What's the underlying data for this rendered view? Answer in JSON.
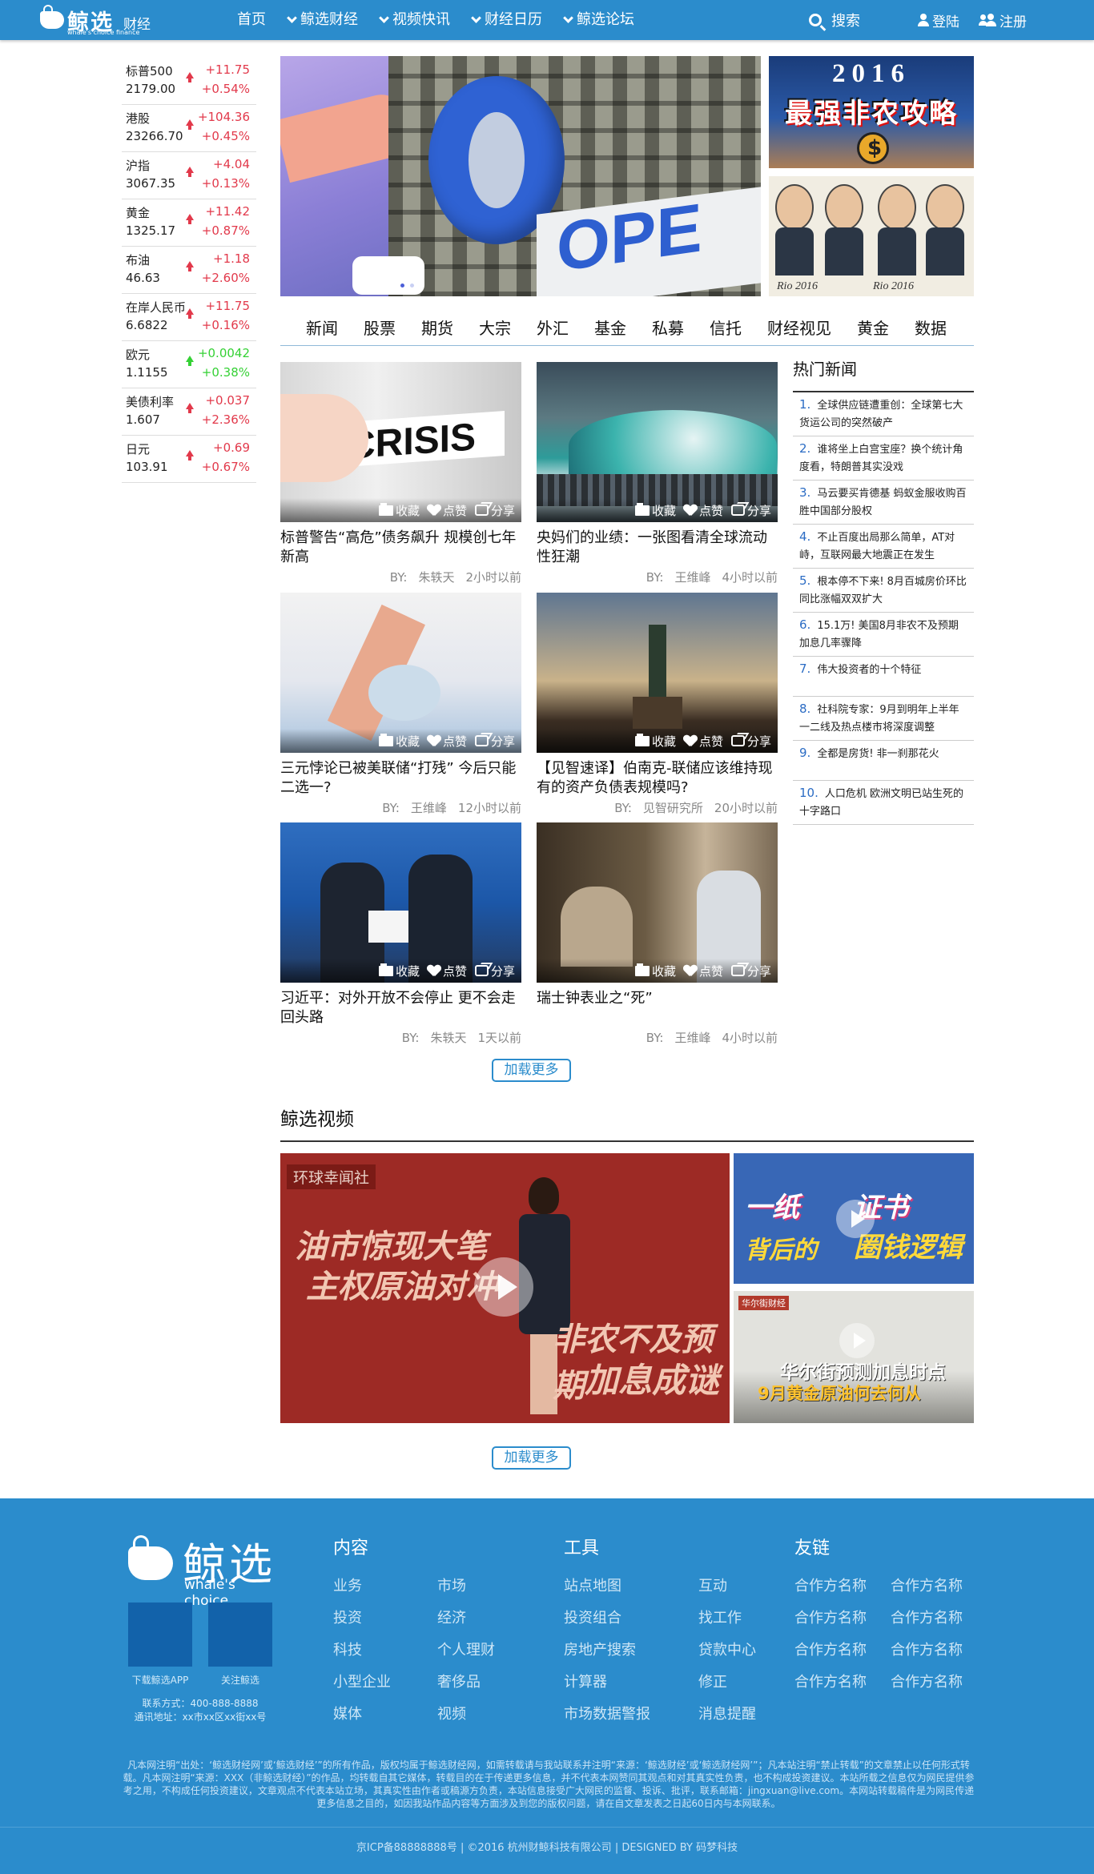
{
  "header": {
    "logo_cn": "鲸选",
    "logo_sub": "财经",
    "logo_en": "whale's choice  finance",
    "nav": [
      {
        "label": "首页",
        "has_dropdown": false
      },
      {
        "label": "鲸选财经",
        "has_dropdown": true
      },
      {
        "label": "视频快讯",
        "has_dropdown": true
      },
      {
        "label": "财经日历",
        "has_dropdown": true
      },
      {
        "label": "鲸选论坛",
        "has_dropdown": true
      }
    ],
    "search_label": "搜索",
    "login_label": "登陆",
    "register_label": "注册"
  },
  "stocks": [
    {
      "name": "标普500",
      "price": "2179.00",
      "change": "+11.75",
      "pct": "+0.54%",
      "dir": "up"
    },
    {
      "name": "港股",
      "price": "23266.70",
      "change": "+104.36",
      "pct": "+0.45%",
      "dir": "up"
    },
    {
      "name": "沪指",
      "price": "3067.35",
      "change": "+4.04",
      "pct": "+0.13%",
      "dir": "up"
    },
    {
      "name": "黄金",
      "price": "1325.17",
      "change": "+11.42",
      "pct": "+0.87%",
      "dir": "up"
    },
    {
      "name": "布油",
      "price": "46.63",
      "change": "+1.18",
      "pct": "+2.60%",
      "dir": "up"
    },
    {
      "name": "在岸人民币",
      "price": "6.6822",
      "change": "+11.75",
      "pct": "+0.16%",
      "dir": "up"
    },
    {
      "name": "欧元",
      "price": "1.1155",
      "change": "+0.0042",
      "pct": "+0.38%",
      "dir": "down"
    },
    {
      "name": "美债利率",
      "price": "1.607",
      "change": "+0.037",
      "pct": "+2.36%",
      "dir": "up"
    },
    {
      "name": "日元",
      "price": "103.91",
      "change": "+0.69",
      "pct": "+0.67%",
      "dir": "up"
    }
  ],
  "banner": {
    "main_text": "OPE",
    "side1_line1": "2016",
    "side1_line2": "最强非农攻略",
    "side2_caption1": "Rio 2016",
    "side2_caption2": "Rio 2016"
  },
  "categories": [
    "新闻",
    "股票",
    "期货",
    "大宗",
    "外汇",
    "基金",
    "私募",
    "信托",
    "财经视见",
    "黄金",
    "数据"
  ],
  "article_actions": {
    "collect": "收藏",
    "like": "点赞",
    "share": "分享"
  },
  "articles": [
    {
      "title": "标普警告“高危”债务飙升 规模创七年新高",
      "author": "朱轶天",
      "time": "2小时以前",
      "by": "BY:",
      "img": "crisis"
    },
    {
      "title": "央妈们的业绩：一张图看清全球流动性狂潮",
      "author": "王维峰",
      "time": "4小时以前",
      "by": "BY:",
      "img": "wave"
    },
    {
      "title": "三元悖论已被美联储“打残” 今后只能二选一?",
      "author": "王维峰",
      "time": "12小时以前",
      "by": "BY:",
      "img": "dancer"
    },
    {
      "title": "【见智速译】伯南克-联储应该维持现有的资产负债表规模吗?",
      "author": "见智研究所",
      "time": "20小时以前",
      "by": "BY:",
      "img": "liberty"
    },
    {
      "title": "习近平：对外开放不会停止 更不会走回头路",
      "author": "朱轶天",
      "time": "1天以前",
      "by": "BY:",
      "img": "meeting"
    },
    {
      "title": "瑞士钟表业之“死”",
      "author": "王维峰",
      "time": "4小时以前",
      "by": "BY:",
      "img": "watch"
    }
  ],
  "hot_news": {
    "title": "热门新闻",
    "items": [
      {
        "num": "1.",
        "text": "全球供应链遭重创：全球第七大货运公司的突然破产"
      },
      {
        "num": "2.",
        "text": "谁将坐上白宫宝座？换个统计角度看，特朗普其实没戏"
      },
      {
        "num": "3.",
        "text": "马云要买肯德基 蚂蚁金服收购百胜中国部分股权"
      },
      {
        "num": "4.",
        "text": "不止百度出局那么简单，AT对峙，互联网最大地震正在发生"
      },
      {
        "num": "5.",
        "text": "根本停不下来! 8月百城房价环比同比涨幅双双扩大"
      },
      {
        "num": "6.",
        "text": "15.1万! 美国8月非农不及预期 加息几率骤降"
      },
      {
        "num": "7.",
        "text": "伟大投资者的十个特征"
      },
      {
        "num": "8.",
        "text": "社科院专家：9月到明年上半年 一二线及热点楼市将深度调整"
      },
      {
        "num": "9.",
        "text": "全都是房货! 非一刹那花火"
      },
      {
        "num": "10.",
        "text": "人口危机 欧洲文明已站生死的十字路口"
      }
    ]
  },
  "load_more": "加载更多",
  "video": {
    "section_title": "鲸选视频",
    "main_tag": "环球幸闻社",
    "main_lines": [
      "油市惊现大笔",
      "主权原油对冲",
      "非农不及预期",
      "加息成谜"
    ],
    "side1_lines": [
      "一纸",
      "背后的",
      "证书",
      "圈钱逻辑"
    ],
    "side2_tag": "华尔街财经",
    "side2_lines": [
      "华尔街预测加息时点",
      "9月黄金原油何去何从"
    ]
  },
  "footer": {
    "logo_cn": "鲸选",
    "logo_en": "whale's choice",
    "qr1_label": "下载鲸选APP",
    "qr2_label": "关注鲸选",
    "contact_phone": "联系方式：400-888-8888",
    "contact_address": "通讯地址：xx市xx区xx街xx号",
    "col1_title": "内容",
    "col1_a": [
      "业务",
      "投资",
      "科技",
      "小型企业",
      "媒体"
    ],
    "col1_b": [
      "市场",
      "经济",
      "个人理财",
      "奢侈品",
      "视频"
    ],
    "col2_title": "工具",
    "col2_a": [
      "站点地图",
      "投资组合",
      "房地产搜索",
      "计算器",
      "市场数据警报"
    ],
    "col2_b": [
      "互动",
      "找工作",
      "贷款中心",
      "修正",
      "消息提醒"
    ],
    "col3_title": "友链",
    "col3_a": [
      "合作方名称",
      "合作方名称",
      "合作方名称",
      "合作方名称"
    ],
    "col3_b": [
      "合作方名称",
      "合作方名称",
      "合作方名称",
      "合作方名称"
    ],
    "disclaimer": "凡本网注明“出处：‘鲸选财经网’或‘鲸选财经’”的所有作品，版权均属于鲸选财经网，如需转载请与我站联系并注明“来源：‘鲸选财经’或‘鲸选财经网’”；凡本站注明“禁止转载”的文章禁止以任何形式转载。凡本网注明“来源：XXX（非鲸选财经）”的作品，均转载自其它媒体，转载目的在于传递更多信息，并不代表本网赞同其观点和对其真实性负责，也不构成投资建议。本站所载之信息仅为网民提供参考之用，不构成任何投资建议，文章观点不代表本站立场，其真实性由作者或稿源方负责，本站信息接受广大网民的监督、投诉、批评，联系邮箱：jingxuan@live.com。本网站转载稿件是为网民传递更多信息之目的，如因我站作品内容等方面涉及到您的版权问题，请在自文章发表之日起60日内与本网联系。",
    "copyright": "京ICP备88888888号 | ©2016 杭州财鲸科技有限公司 | DESIGNED BY 码梦科技"
  },
  "colors": {
    "brand": "#2b8ccc",
    "up": "#e2394b",
    "down": "#35d135"
  }
}
